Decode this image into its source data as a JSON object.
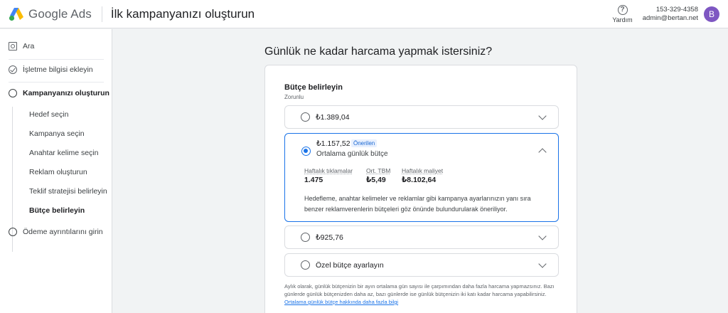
{
  "header": {
    "logo_text": "Google Ads",
    "page_title": "İlk kampanyanızı oluşturun",
    "help_label": "Yardım",
    "account_id": "153-329-4358",
    "account_email": "admin@bertan.net",
    "avatar_letter": "B"
  },
  "sidebar": {
    "search_label": "Ara",
    "step1_label": "İşletme bilgisi ekleyin",
    "step2_label": "Kampanyanızı oluşturun",
    "substeps": [
      "Hedef seçin",
      "Kampanya seçin",
      "Anahtar kelime seçin",
      "Reklam oluşturun",
      "Teklif stratejisi belirleyin",
      "Bütçe belirleyin"
    ],
    "step3_label": "Ödeme ayrıntılarını girin"
  },
  "main": {
    "title": "Günlük ne kadar harcama yapmak istersiniz?",
    "section_title": "Bütçe belirleyin",
    "section_required": "Zorunlu",
    "options": [
      {
        "label": "₺1.389,04"
      },
      {
        "label": "₺1.157,52",
        "badge": "Önerilen",
        "sublabel": "Ortalama günlük bütçe"
      },
      {
        "label": "₺925,76"
      },
      {
        "label": "Özel bütçe ayarlayın"
      }
    ],
    "metrics": [
      {
        "label": "Haftalık tıklamalar",
        "value": "1.475"
      },
      {
        "label": "Ort. TBM",
        "value": "₺5,49"
      },
      {
        "label": "Haftalık maliyet",
        "value": "₺8.102,64"
      }
    ],
    "description": "Hedefleme, anahtar kelimeler ve reklamlar gibi kampanya ayarlarınızın yanı sıra benzer reklamverenlerin bütçeleri göz önünde bulundurularak öneriliyor.",
    "footnote": "Aylık olarak, günlük bütçenizin bir ayın ortalama gün sayısı ile çarpımından daha fazla harcama yapmazsınız. Bazı günlerde günlük bütçenizden daha az, bazı günlerde ise günlük bütçenizin iki katı kadar harcama yapabilirsiniz.",
    "footnote_link": "Ortalama günlük bütçe hakkında daha fazla bilgi"
  },
  "colors": {
    "accent": "#1a73e8",
    "avatar": "#7e57c2"
  },
  "icons": [
    "google-ads-logo",
    "help-circle-icon",
    "search-icon",
    "check-circle-icon",
    "circle-icon",
    "chevron-down-icon",
    "chevron-up-icon",
    "radio-icon"
  ]
}
